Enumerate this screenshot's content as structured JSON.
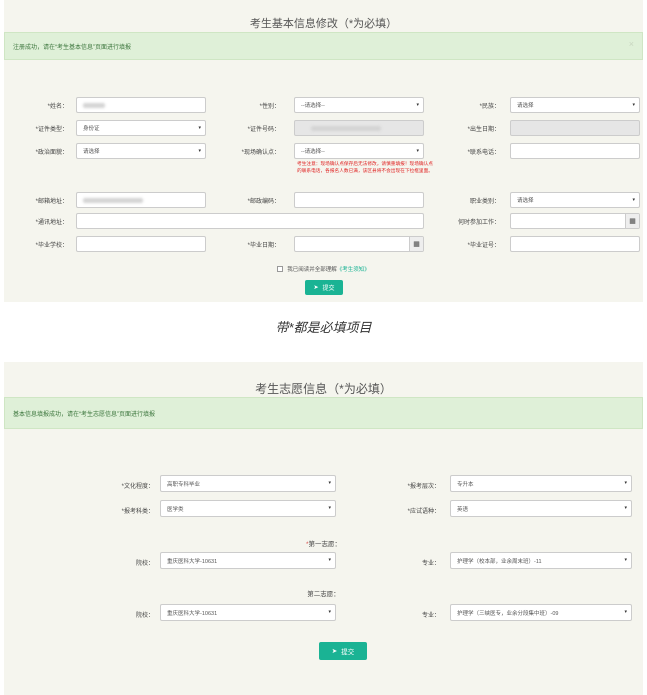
{
  "form1": {
    "title": "考生基本信息修改（*为必填）",
    "alert": "注册成功，请在“考生基本信息”页面进行填报",
    "alert_close": "×",
    "fields": {
      "name": {
        "label": "*姓名："
      },
      "gender": {
        "label": "*性别：",
        "value": "--请选择--"
      },
      "ethnicity": {
        "label": "*民族：",
        "value": "请选择"
      },
      "id_type": {
        "label": "*证件类型：",
        "value": "身份证"
      },
      "id_number": {
        "label": "*证件号码："
      },
      "birth_date": {
        "label": "*出生日期："
      },
      "political": {
        "label": "*政治面貌：",
        "value": "请选择"
      },
      "site": {
        "label": "*现场确认点：",
        "value": "--请选择--"
      },
      "phone": {
        "label": "*联系电话："
      },
      "email": {
        "label": "*邮箱地址："
      },
      "postcode": {
        "label": "*邮政编码："
      },
      "occupation": {
        "label": "职业类别：",
        "value": "请选择"
      },
      "address": {
        "label": "*通讯地址："
      },
      "work_time": {
        "label": "何时参加工作："
      },
      "school": {
        "label": "*毕业学校："
      },
      "grad_date": {
        "label": "*毕业日期："
      },
      "cert_no": {
        "label": "*毕业证号："
      }
    },
    "warning": "考生注意：现场确认点保存后无法修改，请慎重填报！现场确认点的联系电话，各报名人数已满，该区县将不会出现在下拉框里面。",
    "agree_text": "我已阅读并全部理解",
    "agree_link": "《考生须知》",
    "submit": "提交"
  },
  "caption": "带*都是必填项目",
  "form2": {
    "title": "考生志愿信息（*为必填）",
    "alert": "基本信息填报成功，请在“考生志愿信息”页面进行填报",
    "education": {
      "label": "*文化程度：",
      "value": "高职专科毕业"
    },
    "level": {
      "label": "*报考层次：",
      "value": "专升本"
    },
    "category": {
      "label": "*报考科类：",
      "value": "医学类"
    },
    "language": {
      "label": "*应试语种：",
      "value": "英语"
    },
    "first_choice": {
      "star": "*",
      "heading": "第一志愿：",
      "school_label": "院校：",
      "school": "重庆医科大学-10631",
      "major_label": "专业：",
      "major": "护理学（校本部，业余周末班）-11"
    },
    "second_choice": {
      "heading": "第二志愿：",
      "school_label": "院校：",
      "school": "重庆医科大学-10631",
      "major_label": "专业：",
      "major": "护理学（三峡医专，业余分段集中班）-09"
    },
    "submit": "提交"
  },
  "icons": {
    "caret": "▾",
    "calendar": "▦",
    "send": "➤"
  }
}
